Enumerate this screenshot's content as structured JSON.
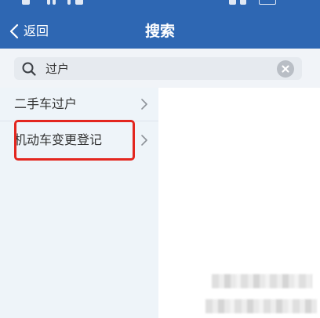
{
  "status_bar": {
    "icons": [
      "sim-icon",
      "signal-icon",
      "wifi-icon",
      "alarm-icon",
      "battery-icon"
    ]
  },
  "header": {
    "back_icon": "chevron-left-icon",
    "back_label": "返回",
    "title": "搜索"
  },
  "search": {
    "search_icon": "search-icon",
    "value": "过户",
    "clear_icon": "clear-circle-icon"
  },
  "results": [
    {
      "label": "二手车过户",
      "icon": "chevron-right-icon"
    },
    {
      "label": "机动车变更登记",
      "icon": "chevron-right-icon"
    }
  ],
  "highlighted_result_index": 1,
  "colors": {
    "header_bg": "#2e67b3",
    "header_text": "#ffffff",
    "list_bg": "#eef4f9",
    "text": "#333333",
    "highlight_border": "#e3261f"
  }
}
